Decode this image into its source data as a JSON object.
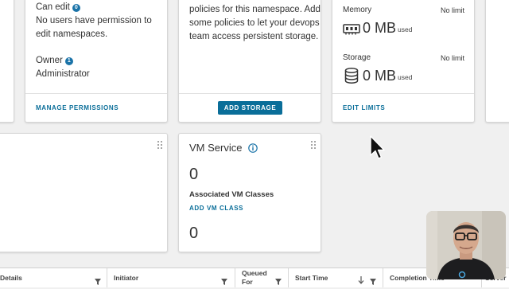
{
  "permissions_card": {
    "can_edit_label": "Can edit",
    "can_edit_count": "0",
    "can_edit_message_line1": "No users have permission to",
    "can_edit_message_line2": "edit namespaces.",
    "owner_label": "Owner",
    "owner_count": "1",
    "owner_value": "Administrator",
    "action_label": "MANAGE PERMISSIONS"
  },
  "storage_card": {
    "message_line1": "policies for this namespace. Add",
    "message_line2": "some policies to let your devops",
    "message_line3": "team access persistent storage.",
    "button_label": "ADD STORAGE"
  },
  "capacity_card": {
    "memory_label": "Memory",
    "memory_limit": "No limit",
    "memory_value": "0 MB",
    "memory_unit": "used",
    "storage_label": "Storage",
    "storage_limit": "No limit",
    "storage_value": "0 MB",
    "storage_unit": "used",
    "action_label": "EDIT LIMITS"
  },
  "vm_service_card": {
    "title": "VM Service",
    "vm_classes_count": "0",
    "vm_classes_label": "Associated VM Classes",
    "add_link": "ADD VM CLASS",
    "second_count": "0"
  },
  "tasks_table": {
    "columns": [
      {
        "label": "Details"
      },
      {
        "label": "Initiator"
      },
      {
        "label": "Queued For"
      },
      {
        "label": "Start Time"
      },
      {
        "label": "Completion Time"
      },
      {
        "label": "Server"
      }
    ]
  },
  "colors": {
    "accent": "#0a6e99",
    "badge": "#1a73a8",
    "background": "#f0f0f0"
  },
  "icons": [
    "info-icon",
    "memory-icon",
    "database-icon",
    "drag-handle-icon",
    "filter-icon",
    "sort-down-icon",
    "mouse-cursor"
  ]
}
